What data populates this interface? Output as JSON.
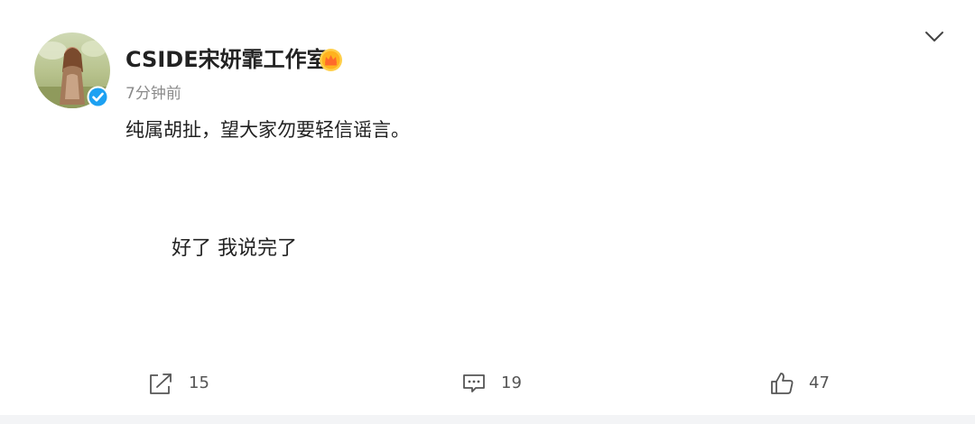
{
  "post": {
    "username": "CSIDE宋妍霏工作室",
    "timestamp": "7分钟前",
    "text": "纯属胡扯，望大家勿要轻信谣言。",
    "caption": "好了 我说完了",
    "badges": {
      "verified_icon": "verified-badge-icon",
      "member_icon": "crown-badge-icon"
    },
    "accent_color": "#ff8200",
    "verified_color": "#1da1f2"
  },
  "actions": {
    "repost_count": "15",
    "comment_count": "19",
    "like_count": "47"
  }
}
